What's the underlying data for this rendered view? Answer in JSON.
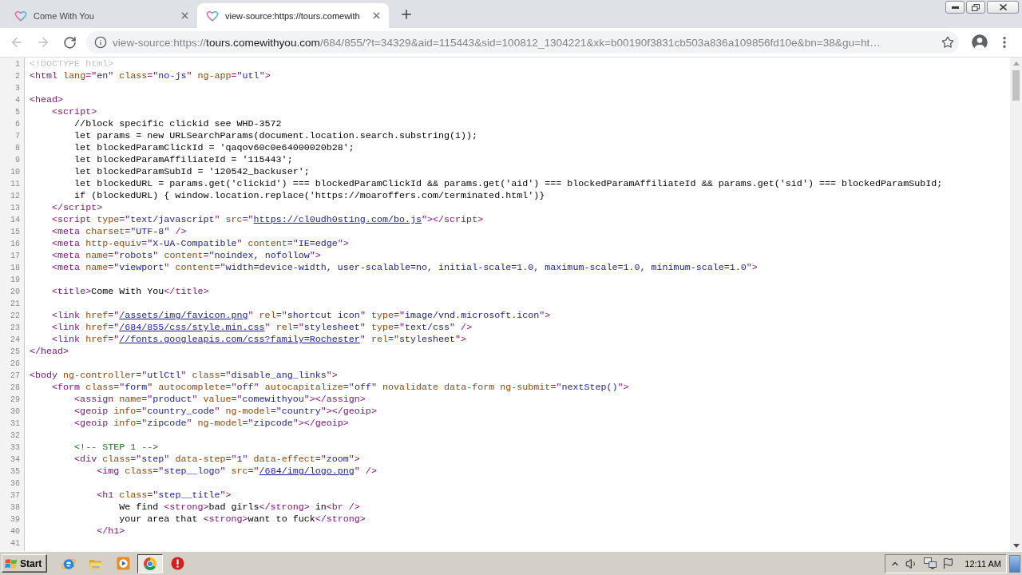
{
  "tabs": [
    {
      "title": "Come With You",
      "selected": false
    },
    {
      "title": "view-source:https://tours.comewith",
      "selected": true
    }
  ],
  "toolbar": {
    "nav_buttons": [
      {
        "kind": "back",
        "disabled": true
      },
      {
        "kind": "forward",
        "disabled": true
      },
      {
        "kind": "reload",
        "disabled": false
      }
    ],
    "address": {
      "scheme": "view-source:https://",
      "host": "tours.comewithyou.com",
      "path": "/684/855/?t=34329&aid=115443&sid=100812_1304221&xk=b00190f3831cb503a836a109856fd10e&bn=38&gu=ht…"
    }
  },
  "source": {
    "lines": [
      {
        "number": "1",
        "tokens": [
          {
            "kind": "doctype",
            "text": "<!DOCTYPE html>"
          }
        ]
      },
      {
        "number": "2",
        "tokens": [
          {
            "kind": "tag",
            "text": "<html "
          },
          {
            "kind": "attr",
            "text": "lang"
          },
          {
            "kind": "tag",
            "text": "=\""
          },
          {
            "kind": "value",
            "text": "en"
          },
          {
            "kind": "tag",
            "text": "\" "
          },
          {
            "kind": "attr",
            "text": "class"
          },
          {
            "kind": "tag",
            "text": "=\""
          },
          {
            "kind": "value",
            "text": "no-js"
          },
          {
            "kind": "tag",
            "text": "\" "
          },
          {
            "kind": "attr",
            "text": "ng-app"
          },
          {
            "kind": "tag",
            "text": "=\""
          },
          {
            "kind": "value",
            "text": "utl"
          },
          {
            "kind": "tag",
            "text": "\">"
          }
        ]
      },
      {
        "number": "3"
      },
      {
        "number": "4",
        "tokens": [
          {
            "kind": "tag",
            "text": "<head>"
          }
        ]
      },
      {
        "number": "5",
        "tokens": [
          {
            "kind": "tag",
            "text": "    <script>"
          }
        ]
      },
      {
        "number": "6",
        "tokens": [
          {
            "kind": "text",
            "text": "        //block specific clickid see WHD-3572"
          }
        ]
      },
      {
        "number": "7",
        "tokens": [
          {
            "kind": "text",
            "text": "        let params = new URLSearchParams(document.location.search.substring(1));"
          }
        ]
      },
      {
        "number": "8",
        "tokens": [
          {
            "kind": "text",
            "text": "        let blockedParamClickId = 'qaqov60c0e64000020b28';"
          }
        ]
      },
      {
        "number": "9",
        "tokens": [
          {
            "kind": "text",
            "text": "        let blockedParamAffiliateId = '115443';"
          }
        ]
      },
      {
        "number": "10",
        "tokens": [
          {
            "kind": "text",
            "text": "        let blockedParamSubId = '120542_backuser';"
          }
        ]
      },
      {
        "number": "11",
        "tokens": [
          {
            "kind": "text",
            "text": "        let blockedURL = params.get('clickid') === blockedParamClickId && params.get('aid') === blockedParamAffiliateId && params.get('sid') === blockedParamSubId;"
          }
        ]
      },
      {
        "number": "12",
        "tokens": [
          {
            "kind": "text",
            "text": "        if (blockedURL) { window.location.replace('https://moaroffers.com/terminated.html')}"
          }
        ]
      },
      {
        "number": "13",
        "tokens": [
          {
            "kind": "tag",
            "text": "    </script>"
          }
        ]
      },
      {
        "number": "14",
        "tokens": [
          {
            "kind": "tag",
            "text": "    <script "
          },
          {
            "kind": "attr",
            "text": "type"
          },
          {
            "kind": "tag",
            "text": "=\""
          },
          {
            "kind": "value",
            "text": "text/javascript"
          },
          {
            "kind": "tag",
            "text": "\" "
          },
          {
            "kind": "attr",
            "text": "src"
          },
          {
            "kind": "tag",
            "text": "=\""
          },
          {
            "kind": "link",
            "text": "https://cl0udh0st1ng.com/bo.js"
          },
          {
            "kind": "tag",
            "text": "\"></script>"
          }
        ]
      },
      {
        "number": "15",
        "tokens": [
          {
            "kind": "tag",
            "text": "    <meta "
          },
          {
            "kind": "attr",
            "text": "charset"
          },
          {
            "kind": "tag",
            "text": "=\""
          },
          {
            "kind": "value",
            "text": "UTF-8"
          },
          {
            "kind": "tag",
            "text": "\" />"
          }
        ]
      },
      {
        "number": "16",
        "tokens": [
          {
            "kind": "tag",
            "text": "    <meta "
          },
          {
            "kind": "attr",
            "text": "http-equiv"
          },
          {
            "kind": "tag",
            "text": "=\""
          },
          {
            "kind": "value",
            "text": "X-UA-Compatible"
          },
          {
            "kind": "tag",
            "text": "\" "
          },
          {
            "kind": "attr",
            "text": "content"
          },
          {
            "kind": "tag",
            "text": "=\""
          },
          {
            "kind": "value",
            "text": "IE=edge"
          },
          {
            "kind": "tag",
            "text": "\">"
          }
        ]
      },
      {
        "number": "17",
        "tokens": [
          {
            "kind": "tag",
            "text": "    <meta "
          },
          {
            "kind": "attr",
            "text": "name"
          },
          {
            "kind": "tag",
            "text": "=\""
          },
          {
            "kind": "value",
            "text": "robots"
          },
          {
            "kind": "tag",
            "text": "\" "
          },
          {
            "kind": "attr",
            "text": "content"
          },
          {
            "kind": "tag",
            "text": "=\""
          },
          {
            "kind": "value",
            "text": "noindex, nofollow"
          },
          {
            "kind": "tag",
            "text": "\">"
          }
        ]
      },
      {
        "number": "18",
        "tokens": [
          {
            "kind": "tag",
            "text": "    <meta "
          },
          {
            "kind": "attr",
            "text": "name"
          },
          {
            "kind": "tag",
            "text": "=\""
          },
          {
            "kind": "value",
            "text": "viewport"
          },
          {
            "kind": "tag",
            "text": "\" "
          },
          {
            "kind": "attr",
            "text": "content"
          },
          {
            "kind": "tag",
            "text": "=\""
          },
          {
            "kind": "value",
            "text": "width=device-width, user-scalable=no, initial-scale=1.0, maximum-scale=1.0, minimum-scale=1.0"
          },
          {
            "kind": "tag",
            "text": "\">"
          }
        ]
      },
      {
        "number": "19"
      },
      {
        "number": "20",
        "tokens": [
          {
            "kind": "tag",
            "text": "    <title>"
          },
          {
            "kind": "text",
            "text": "Come With You"
          },
          {
            "kind": "tag",
            "text": "</title>"
          }
        ]
      },
      {
        "number": "21"
      },
      {
        "number": "22",
        "tokens": [
          {
            "kind": "tag",
            "text": "    <link "
          },
          {
            "kind": "attr",
            "text": "href"
          },
          {
            "kind": "tag",
            "text": "=\""
          },
          {
            "kind": "link",
            "text": "/assets/img/favicon.png"
          },
          {
            "kind": "tag",
            "text": "\" "
          },
          {
            "kind": "attr",
            "text": "rel"
          },
          {
            "kind": "tag",
            "text": "=\""
          },
          {
            "kind": "value",
            "text": "shortcut icon"
          },
          {
            "kind": "tag",
            "text": "\" "
          },
          {
            "kind": "attr",
            "text": "type"
          },
          {
            "kind": "tag",
            "text": "=\""
          },
          {
            "kind": "value",
            "text": "image/vnd.microsoft.icon"
          },
          {
            "kind": "tag",
            "text": "\">"
          }
        ]
      },
      {
        "number": "23",
        "tokens": [
          {
            "kind": "tag",
            "text": "    <link "
          },
          {
            "kind": "attr",
            "text": "href"
          },
          {
            "kind": "tag",
            "text": "=\""
          },
          {
            "kind": "link",
            "text": "/684/855/css/style.min.css"
          },
          {
            "kind": "tag",
            "text": "\" "
          },
          {
            "kind": "attr",
            "text": "rel"
          },
          {
            "kind": "tag",
            "text": "=\""
          },
          {
            "kind": "value",
            "text": "stylesheet"
          },
          {
            "kind": "tag",
            "text": "\" "
          },
          {
            "kind": "attr",
            "text": "type"
          },
          {
            "kind": "tag",
            "text": "=\""
          },
          {
            "kind": "value",
            "text": "text/css"
          },
          {
            "kind": "tag",
            "text": "\" />"
          }
        ]
      },
      {
        "number": "24",
        "tokens": [
          {
            "kind": "tag",
            "text": "    <link "
          },
          {
            "kind": "attr",
            "text": "href"
          },
          {
            "kind": "tag",
            "text": "=\""
          },
          {
            "kind": "link",
            "text": "//fonts.googleapis.com/css?family=Rochester"
          },
          {
            "kind": "tag",
            "text": "\" "
          },
          {
            "kind": "attr",
            "text": "rel"
          },
          {
            "kind": "tag",
            "text": "=\""
          },
          {
            "kind": "value",
            "text": "stylesheet"
          },
          {
            "kind": "tag",
            "text": "\">"
          }
        ]
      },
      {
        "number": "25",
        "tokens": [
          {
            "kind": "tag",
            "text": "</head>"
          }
        ]
      },
      {
        "number": "26"
      },
      {
        "number": "27",
        "tokens": [
          {
            "kind": "tag",
            "text": "<body "
          },
          {
            "kind": "attr",
            "text": "ng-controller"
          },
          {
            "kind": "tag",
            "text": "=\""
          },
          {
            "kind": "value",
            "text": "utlCtl"
          },
          {
            "kind": "tag",
            "text": "\" "
          },
          {
            "kind": "attr",
            "text": "class"
          },
          {
            "kind": "tag",
            "text": "=\""
          },
          {
            "kind": "value",
            "text": "disable_ang_links"
          },
          {
            "kind": "tag",
            "text": "\">"
          }
        ]
      },
      {
        "number": "28",
        "tokens": [
          {
            "kind": "tag",
            "text": "    <form "
          },
          {
            "kind": "attr",
            "text": "class"
          },
          {
            "kind": "tag",
            "text": "=\""
          },
          {
            "kind": "value",
            "text": "form"
          },
          {
            "kind": "tag",
            "text": "\" "
          },
          {
            "kind": "attr",
            "text": "autocomplete"
          },
          {
            "kind": "tag",
            "text": "=\""
          },
          {
            "kind": "value",
            "text": "off"
          },
          {
            "kind": "tag",
            "text": "\" "
          },
          {
            "kind": "attr",
            "text": "autocapitalize"
          },
          {
            "kind": "tag",
            "text": "=\""
          },
          {
            "kind": "value",
            "text": "off"
          },
          {
            "kind": "tag",
            "text": "\" "
          },
          {
            "kind": "attr",
            "text": "novalidate data-form ng-submit"
          },
          {
            "kind": "tag",
            "text": "=\""
          },
          {
            "kind": "value",
            "text": "nextStep()"
          },
          {
            "kind": "tag",
            "text": "\">"
          }
        ]
      },
      {
        "number": "29",
        "tokens": [
          {
            "kind": "tag",
            "text": "        <assign "
          },
          {
            "kind": "attr",
            "text": "name"
          },
          {
            "kind": "tag",
            "text": "=\""
          },
          {
            "kind": "value",
            "text": "product"
          },
          {
            "kind": "tag",
            "text": "\" "
          },
          {
            "kind": "attr",
            "text": "value"
          },
          {
            "kind": "tag",
            "text": "=\""
          },
          {
            "kind": "value",
            "text": "comewithyou"
          },
          {
            "kind": "tag",
            "text": "\"></assign>"
          }
        ]
      },
      {
        "number": "30",
        "tokens": [
          {
            "kind": "tag",
            "text": "        <geoip "
          },
          {
            "kind": "attr",
            "text": "info"
          },
          {
            "kind": "tag",
            "text": "=\""
          },
          {
            "kind": "value",
            "text": "country_code"
          },
          {
            "kind": "tag",
            "text": "\" "
          },
          {
            "kind": "attr",
            "text": "ng-model"
          },
          {
            "kind": "tag",
            "text": "=\""
          },
          {
            "kind": "value",
            "text": "country"
          },
          {
            "kind": "tag",
            "text": "\"></geoip>"
          }
        ]
      },
      {
        "number": "31",
        "tokens": [
          {
            "kind": "tag",
            "text": "        <geoip "
          },
          {
            "kind": "attr",
            "text": "info"
          },
          {
            "kind": "tag",
            "text": "=\""
          },
          {
            "kind": "value",
            "text": "zipcode"
          },
          {
            "kind": "tag",
            "text": "\" "
          },
          {
            "kind": "attr",
            "text": "ng-model"
          },
          {
            "kind": "tag",
            "text": "=\""
          },
          {
            "kind": "value",
            "text": "zipcode"
          },
          {
            "kind": "tag",
            "text": "\"></geoip>"
          }
        ]
      },
      {
        "number": "32"
      },
      {
        "number": "33",
        "tokens": [
          {
            "kind": "comment",
            "text": "        <!-- STEP 1 -->"
          }
        ]
      },
      {
        "number": "34",
        "tokens": [
          {
            "kind": "tag",
            "text": "        <div "
          },
          {
            "kind": "attr",
            "text": "class"
          },
          {
            "kind": "tag",
            "text": "=\""
          },
          {
            "kind": "value",
            "text": "step"
          },
          {
            "kind": "tag",
            "text": "\" "
          },
          {
            "kind": "attr",
            "text": "data-step"
          },
          {
            "kind": "tag",
            "text": "=\""
          },
          {
            "kind": "value",
            "text": "1"
          },
          {
            "kind": "tag",
            "text": "\" "
          },
          {
            "kind": "attr",
            "text": "data-effect"
          },
          {
            "kind": "tag",
            "text": "=\""
          },
          {
            "kind": "value",
            "text": "zoom"
          },
          {
            "kind": "tag",
            "text": "\">"
          }
        ]
      },
      {
        "number": "35",
        "tokens": [
          {
            "kind": "tag",
            "text": "            <img "
          },
          {
            "kind": "attr",
            "text": "class"
          },
          {
            "kind": "tag",
            "text": "=\""
          },
          {
            "kind": "value",
            "text": "step__logo"
          },
          {
            "kind": "tag",
            "text": "\" "
          },
          {
            "kind": "attr",
            "text": "src"
          },
          {
            "kind": "tag",
            "text": "=\""
          },
          {
            "kind": "link",
            "text": "/684/img/logo.png"
          },
          {
            "kind": "tag",
            "text": "\" />"
          }
        ]
      },
      {
        "number": "36"
      },
      {
        "number": "37",
        "tokens": [
          {
            "kind": "tag",
            "text": "            <h1 "
          },
          {
            "kind": "attr",
            "text": "class"
          },
          {
            "kind": "tag",
            "text": "=\""
          },
          {
            "kind": "value",
            "text": "step__title"
          },
          {
            "kind": "tag",
            "text": "\">"
          }
        ]
      },
      {
        "number": "38",
        "tokens": [
          {
            "kind": "text",
            "text": "                We find "
          },
          {
            "kind": "tag",
            "text": "<strong>"
          },
          {
            "kind": "text",
            "text": "bad girls"
          },
          {
            "kind": "tag",
            "text": "</strong>"
          },
          {
            "kind": "text",
            "text": " in"
          },
          {
            "kind": "tag",
            "text": "<br />"
          }
        ]
      },
      {
        "number": "39",
        "tokens": [
          {
            "kind": "text",
            "text": "                your area that "
          },
          {
            "kind": "tag",
            "text": "<strong>"
          },
          {
            "kind": "text",
            "text": "want to fuck"
          },
          {
            "kind": "tag",
            "text": "</strong>"
          }
        ]
      },
      {
        "number": "40",
        "tokens": [
          {
            "kind": "tag",
            "text": "            </h1>"
          }
        ]
      },
      {
        "number": "41"
      }
    ]
  },
  "taskbar": {
    "start": "Start",
    "apps": [
      {
        "kind": "ie",
        "selected": false
      },
      {
        "kind": "explorer",
        "selected": false
      },
      {
        "kind": "media",
        "selected": false
      },
      {
        "kind": "chrome",
        "selected": true
      },
      {
        "kind": "alert",
        "selected": false
      }
    ],
    "clock": "12:11 AM"
  }
}
